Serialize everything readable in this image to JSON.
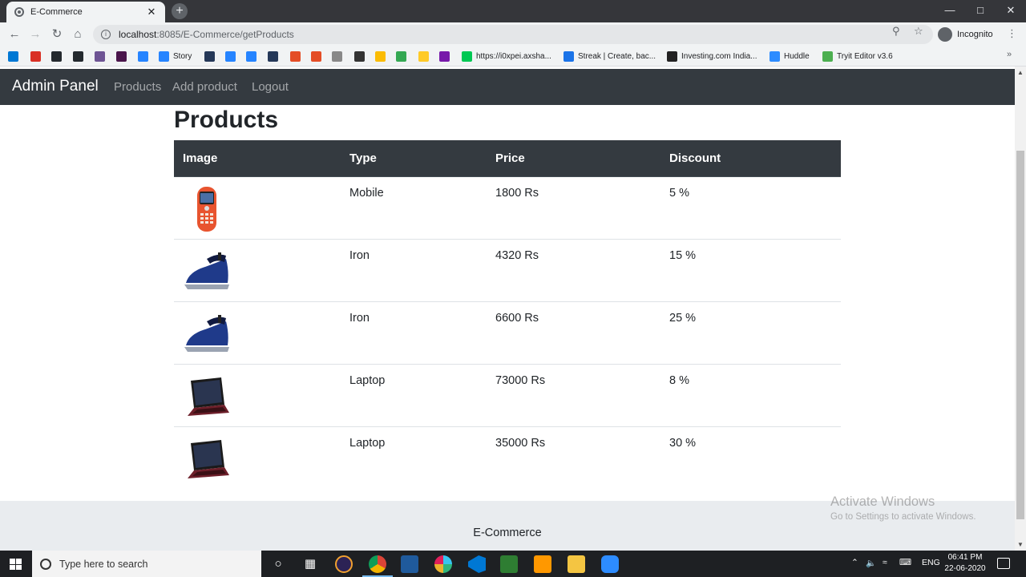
{
  "browser": {
    "tab_title": "E-Commerce",
    "tab_close": "✕",
    "new_tab": "+",
    "url_host": "localhost",
    "url_path": ":8085/E-Commerce/getProducts",
    "incognito_label": "Incognito",
    "bookmarks": [
      {
        "label": "",
        "color": "#0078d4"
      },
      {
        "label": "",
        "color": "#d93025"
      },
      {
        "label": "",
        "color": "#24292e"
      },
      {
        "label": "",
        "color": "#24292e"
      },
      {
        "label": "",
        "color": "#6e5494"
      },
      {
        "label": "",
        "color": "#4a154b"
      },
      {
        "label": "",
        "color": "#2684ff"
      },
      {
        "label": "Story",
        "color": "#2684ff"
      },
      {
        "label": "",
        "color": "#253858"
      },
      {
        "label": "",
        "color": "#2684ff"
      },
      {
        "label": "",
        "color": "#2684ff"
      },
      {
        "label": "",
        "color": "#253858"
      },
      {
        "label": "",
        "color": "#e44d26"
      },
      {
        "label": "",
        "color": "#e44d26"
      },
      {
        "label": "",
        "color": "#888888"
      },
      {
        "label": "",
        "color": "#333333"
      },
      {
        "label": "",
        "color": "#fbbc04"
      },
      {
        "label": "",
        "color": "#34a853"
      },
      {
        "label": "",
        "color": "#ffca28"
      },
      {
        "label": "",
        "color": "#7719aa"
      },
      {
        "label": "https://i0xpei.axsha...",
        "color": "#00c853"
      },
      {
        "label": "Streak | Create, bac...",
        "color": "#1a73e8"
      },
      {
        "label": "Investing.com India...",
        "color": "#222222"
      },
      {
        "label": "Huddle",
        "color": "#2d8cff"
      },
      {
        "label": "Tryit Editor v3.6",
        "color": "#4caf50"
      }
    ],
    "bookmarks_more": "»"
  },
  "navbar": {
    "brand": "Admin Panel",
    "links": [
      "Products",
      "Add product",
      "Logout"
    ]
  },
  "page": {
    "heading": "Products",
    "table_headers": [
      "Image",
      "Type",
      "Price",
      "Discount"
    ],
    "products": [
      {
        "image": "mobile-phone",
        "type": "Mobile",
        "price": "1800 Rs",
        "discount": "5 %"
      },
      {
        "image": "iron",
        "type": "Iron",
        "price": "4320 Rs",
        "discount": "15 %"
      },
      {
        "image": "iron",
        "type": "Iron",
        "price": "6600 Rs",
        "discount": "25 %"
      },
      {
        "image": "laptop",
        "type": "Laptop",
        "price": "73000 Rs",
        "discount": "8 %"
      },
      {
        "image": "laptop",
        "type": "Laptop",
        "price": "35000 Rs",
        "discount": "30 %"
      }
    ],
    "footer": "E-Commerce"
  },
  "watermark": {
    "line1": "Activate Windows",
    "line2": "Go to Settings to activate Windows."
  },
  "taskbar": {
    "search_placeholder": "Type here to search",
    "language": "ENG",
    "time": "06:41 PM",
    "date": "22-06-2020"
  },
  "colors": {
    "navbar": "#343a40",
    "table_header": "#343a40",
    "footer": "#e9ecef"
  }
}
